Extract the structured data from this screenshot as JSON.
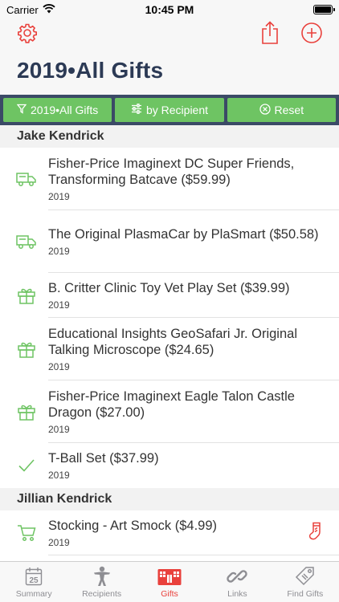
{
  "status": {
    "carrier": "Carrier",
    "time": "10:45 PM"
  },
  "page": {
    "title": "2019•All Gifts"
  },
  "filters": {
    "period_label": "2019•All Gifts",
    "group_label": "by Recipient",
    "reset_label": "Reset"
  },
  "sections": [
    {
      "name": "Jake Kendrick",
      "items": [
        {
          "icon": "truck-icon",
          "title": "Fisher-Price Imaginext DC Super Friends, Transforming Batcave ($59.99)",
          "year": "2019"
        },
        {
          "icon": "truck-icon",
          "title": "The Original PlasmaCar by PlaSmart ($50.58)",
          "year": "2019"
        },
        {
          "icon": "gift-icon",
          "title": "B. Critter Clinic Toy Vet Play Set ($39.99)",
          "year": "2019"
        },
        {
          "icon": "gift-icon",
          "title": "Educational Insights GeoSafari Jr. Original Talking Microscope ($24.65)",
          "year": "2019"
        },
        {
          "icon": "gift-icon",
          "title": "Fisher-Price Imaginext Eagle Talon Castle Dragon ($27.00)",
          "year": "2019"
        },
        {
          "icon": "checkmark-icon",
          "title": "T-Ball Set ($37.99)",
          "year": "2019"
        }
      ]
    },
    {
      "name": "Jillian Kendrick",
      "items": [
        {
          "icon": "cart-icon",
          "title": "Stocking - Art Smock ($4.99)",
          "year": "2019",
          "badge": "stocking-icon"
        }
      ]
    }
  ],
  "tabs": [
    {
      "label": "Summary",
      "icon": "calendar-icon"
    },
    {
      "label": "Recipients",
      "icon": "person-icon"
    },
    {
      "label": "Gifts",
      "icon": "gifts-icon",
      "active": true
    },
    {
      "label": "Links",
      "icon": "link-icon"
    },
    {
      "label": "Find Gifts",
      "icon": "tag-icon"
    }
  ],
  "colors": {
    "accent": "#e9413c",
    "green": "#6ec463",
    "navy": "#3b4a66",
    "title": "#2c3a55"
  }
}
